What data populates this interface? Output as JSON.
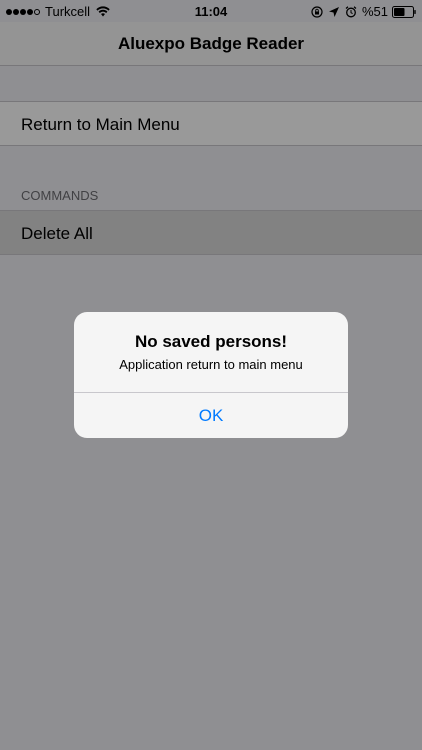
{
  "status_bar": {
    "carrier": "Turkcell",
    "time": "11:04",
    "battery_percent": "%51",
    "signal_bars": 4,
    "signal_total": 5
  },
  "nav": {
    "title": "Aluexpo Badge Reader"
  },
  "table": {
    "return_label": "Return to Main Menu",
    "section_header": "COMMANDS",
    "delete_label": "Delete All"
  },
  "alert": {
    "title": "No saved persons!",
    "message": "Application return to main menu",
    "button_label": "OK"
  },
  "colors": {
    "accent": "#007aff",
    "background": "#efeff4",
    "overlay": "rgba(0,0,0,0.4)"
  },
  "icons": {
    "wifi": "wifi-icon",
    "lock_rotation": "orientation-lock-icon",
    "location": "location-arrow-icon",
    "alarm": "alarm-icon",
    "battery": "battery-icon"
  }
}
